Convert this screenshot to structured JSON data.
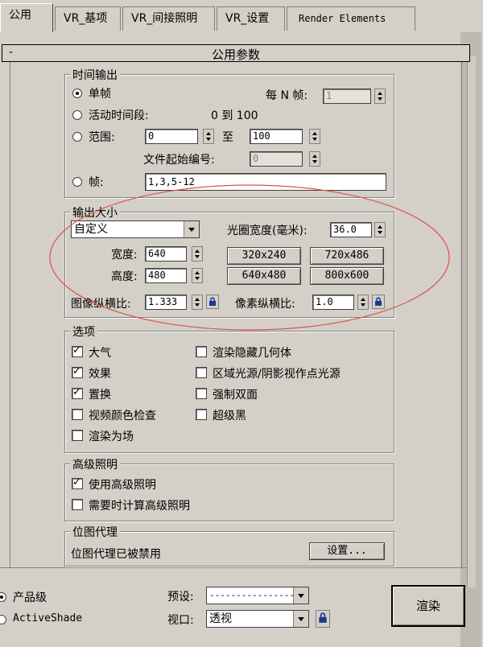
{
  "tabs": [
    "公用",
    "VR_基项",
    "VR_间接照明",
    "VR_设置",
    "Render Elements"
  ],
  "rollout": {
    "minus": "-",
    "title": "公用参数"
  },
  "time_output": {
    "title": "时间输出",
    "single": "单帧",
    "every_n_label": "每 N 帧:",
    "every_n_value": "1",
    "active_segment": "活动时间段:",
    "active_range": "0 到 100",
    "range": "范围:",
    "range_from": "0",
    "range_to_label": "至",
    "range_to": "100",
    "file_start_label": "文件起始编号:",
    "file_start_value": "0",
    "frames": "帧:",
    "frames_value": "1,3,5-12"
  },
  "output_size": {
    "title": "输出大小",
    "preset": "自定义",
    "aperture_label": "光圈宽度(毫米):",
    "aperture_value": "36.0",
    "width_label": "宽度:",
    "width_value": "640",
    "height_label": "高度:",
    "height_value": "480",
    "presets": [
      "320x240",
      "720x486",
      "640x480",
      "800x600"
    ],
    "image_aspect_label": "图像纵横比:",
    "image_aspect_value": "1.333",
    "pixel_aspect_label": "像素纵横比:",
    "pixel_aspect_value": "1.0"
  },
  "options": {
    "title": "选项",
    "left": [
      {
        "label": "大气",
        "checked": true
      },
      {
        "label": "效果",
        "checked": true
      },
      {
        "label": "置换",
        "checked": true
      },
      {
        "label": "视频颜色检查",
        "checked": false
      },
      {
        "label": "渲染为场",
        "checked": false
      }
    ],
    "right": [
      {
        "label": "渲染隐藏几何体",
        "checked": false
      },
      {
        "label": "区域光源/阴影视作点光源",
        "checked": false
      },
      {
        "label": "强制双面",
        "checked": false
      },
      {
        "label": "超级黑",
        "checked": false
      }
    ]
  },
  "advanced_lighting": {
    "title": "高级照明",
    "use": "使用高级照明",
    "compute": "需要时计算高级照明"
  },
  "bitmap_proxy": {
    "title": "位图代理",
    "status": "位图代理已被禁用",
    "settings": "设置..."
  },
  "footer": {
    "production": "产品级",
    "activeshade": "ActiveShade",
    "preset_label": "预设:",
    "preset_value": "-------------------",
    "viewport_label": "视口:",
    "viewport_value": "透视",
    "render": "渲染"
  },
  "annotation_color": "#d9534f"
}
